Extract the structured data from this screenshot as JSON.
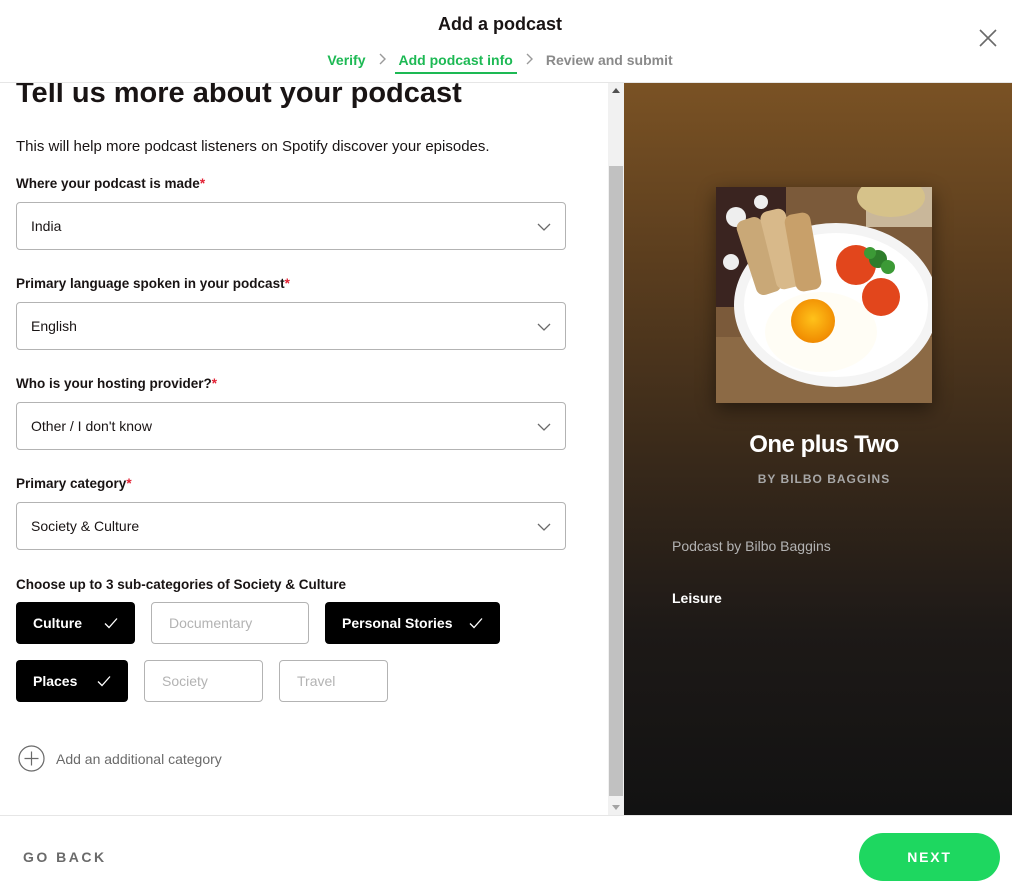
{
  "header": {
    "title": "Add a podcast",
    "steps": [
      {
        "label": "Verify",
        "state": "done"
      },
      {
        "label": "Add podcast info",
        "state": "active"
      },
      {
        "label": "Review and submit",
        "state": "todo"
      }
    ]
  },
  "form": {
    "heading": "Tell us more about your podcast",
    "intro": "This will help more podcast listeners on Spotify discover your episodes.",
    "fields": [
      {
        "label": "Where your podcast is made",
        "required": "*",
        "value": "India"
      },
      {
        "label": "Primary language spoken in your podcast",
        "required": "*",
        "value": "English"
      },
      {
        "label": "Who is your hosting provider?",
        "required": "*",
        "value": "Other / I don't know"
      },
      {
        "label": "Primary category",
        "required": "*",
        "value": "Society & Culture"
      }
    ],
    "subcategory_label": "Choose up to 3 sub-categories of Society & Culture",
    "subcategories": [
      {
        "label": "Culture",
        "selected": true
      },
      {
        "label": "Documentary",
        "selected": false
      },
      {
        "label": "Personal Stories",
        "selected": true
      },
      {
        "label": "Places",
        "selected": true
      },
      {
        "label": "Society",
        "selected": false
      },
      {
        "label": "Travel",
        "selected": false
      }
    ],
    "add_category": "Add an additional category"
  },
  "preview": {
    "title": "One plus Two",
    "byline": "BY BILBO BAGGINS",
    "description": "Podcast by Bilbo Baggins",
    "category": "Leisure"
  },
  "footer": {
    "back": "GO BACK",
    "next": "NEXT"
  },
  "colors": {
    "accent": "#1ed760",
    "step_green": "#1db954",
    "required": "#e22134"
  }
}
